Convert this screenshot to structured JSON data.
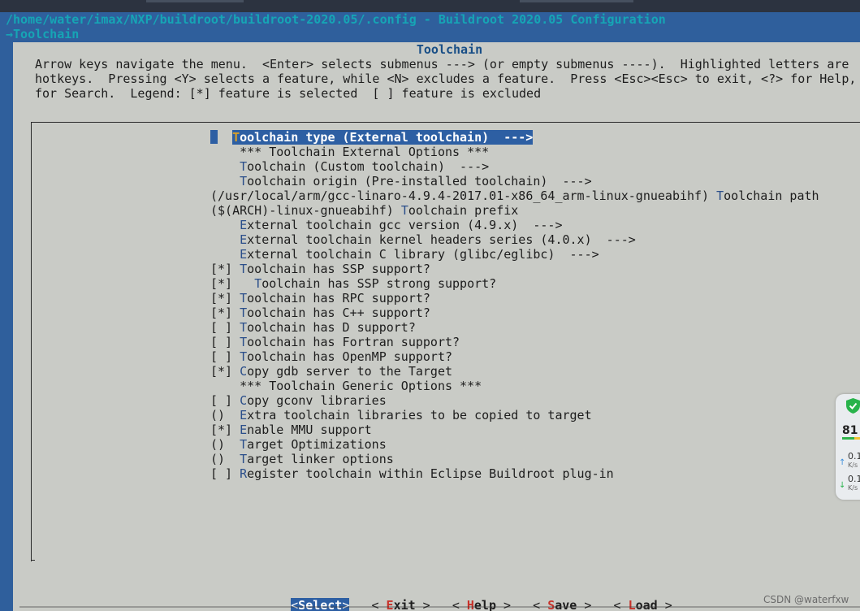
{
  "backtitle": "/home/water/imax/NXP/buildroot/buildroot-2020.05/.config - Buildroot 2020.05 Configuration",
  "breadcrumb": "→Toolchain",
  "window_title": "Toolchain",
  "help": [
    "Arrow keys navigate the menu.  <Enter> selects submenus ---> (or empty submenus ----).  Highlighted letters are",
    "hotkeys.  Pressing <Y> selects a feature, while <N> excludes a feature.  Press <Esc><Esc> to exit, <?> for Help,",
    "for Search.  Legend: [*] feature is selected  [ ] feature is excluded"
  ],
  "menu": [
    {
      "prefix": "",
      "hot": "T",
      "rest": "oolchain type (External toolchain)  --->",
      "selected": true
    },
    {
      "prefix": "    ",
      "hot": "",
      "rest": "*** Toolchain External Options ***"
    },
    {
      "prefix": "    ",
      "hot": "T",
      "rest": "oolchain (Custom toolchain)  --->"
    },
    {
      "prefix": "    ",
      "hot": "T",
      "rest": "oolchain origin (Pre-installed toolchain)  --->"
    },
    {
      "prefix": "(/usr/local/arm/gcc-linaro-4.9.4-2017.01-x86_64_arm-linux-gnueabihf) ",
      "hot": "T",
      "rest": "oolchain path"
    },
    {
      "prefix": "($(ARCH)-linux-gnueabihf) ",
      "hot": "T",
      "rest": "oolchain prefix"
    },
    {
      "prefix": "    ",
      "hot": "E",
      "rest": "xternal toolchain gcc version (4.9.x)  --->"
    },
    {
      "prefix": "    ",
      "hot": "E",
      "rest": "xternal toolchain kernel headers series (4.0.x)  --->"
    },
    {
      "prefix": "    ",
      "hot": "E",
      "rest": "xternal toolchain C library (glibc/eglibc)  --->"
    },
    {
      "prefix": "[*] ",
      "hot": "T",
      "rest": "oolchain has SSP support?"
    },
    {
      "prefix": "[*]   ",
      "hot": "T",
      "rest": "oolchain has SSP strong support?"
    },
    {
      "prefix": "[*] ",
      "hot": "T",
      "rest": "oolchain has RPC support?"
    },
    {
      "prefix": "[*] ",
      "hot": "T",
      "rest": "oolchain has C++ support?"
    },
    {
      "prefix": "[ ] ",
      "hot": "T",
      "rest": "oolchain has D support?"
    },
    {
      "prefix": "[ ] ",
      "hot": "T",
      "rest": "oolchain has Fortran support?"
    },
    {
      "prefix": "[ ] ",
      "hot": "T",
      "rest": "oolchain has OpenMP support?"
    },
    {
      "prefix": "[*] ",
      "hot": "C",
      "rest": "opy gdb server to the Target"
    },
    {
      "prefix": "    ",
      "hot": "",
      "rest": "*** Toolchain Generic Options ***"
    },
    {
      "prefix": "[ ] ",
      "hot": "C",
      "rest": "opy gconv libraries"
    },
    {
      "prefix": "()  ",
      "hot": "E",
      "rest": "xtra toolchain libraries to be copied to target"
    },
    {
      "prefix": "[*] ",
      "hot": "E",
      "rest": "nable MMU support"
    },
    {
      "prefix": "()  ",
      "hot": "T",
      "rest": "arget Optimizations"
    },
    {
      "prefix": "()  ",
      "hot": "T",
      "rest": "arget linker options"
    },
    {
      "prefix": "[ ] ",
      "hot": "R",
      "rest": "egister toolchain within Eclipse Buildroot plug-in"
    }
  ],
  "buttons": [
    {
      "hot": "S",
      "rest": "elect",
      "active": true
    },
    {
      "hot": "E",
      "rest": "xit"
    },
    {
      "hot": "H",
      "rest": "elp"
    },
    {
      "hot": "S",
      "rest": "ave"
    },
    {
      "hot": "L",
      "rest": "oad"
    }
  ],
  "widget": {
    "score": "81",
    "up_rate": "0.1",
    "down_rate": "0.1",
    "unit": "K/s",
    "shield_color": "#28b34b"
  },
  "watermark": "CSDN @waterfxw",
  "colors": {
    "terminal_bg": "#2f5f9c",
    "window_bg": "#c9cbc6",
    "title_cyan": "#16a5b5",
    "highlight": "#2d5fa3",
    "hotkey_button": "#c8322a"
  }
}
